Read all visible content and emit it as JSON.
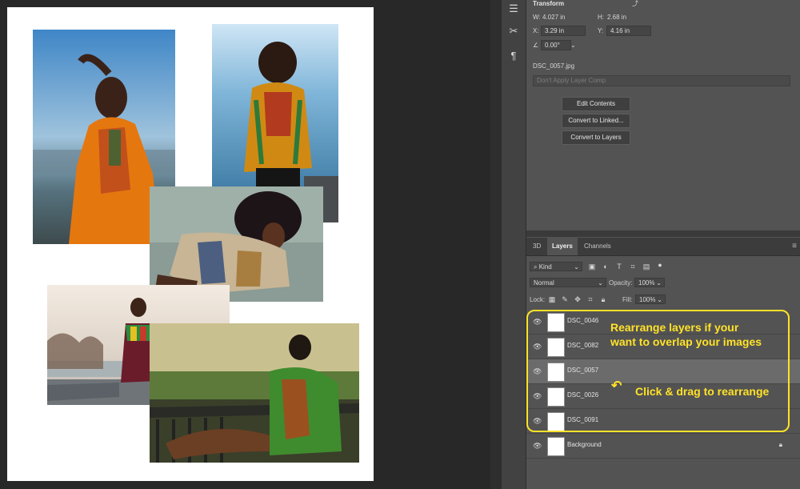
{
  "properties": {
    "section_title": "Transform",
    "width_label": "W:",
    "width_value": "4.027 in",
    "height_label": "H:",
    "height_value": "2.68 in",
    "x_label": "X:",
    "x_value": "3.29 in",
    "y_label": "Y:",
    "y_value": "4.16 in",
    "angle_value": "0.00°",
    "filename": "DSC_0057.jpg",
    "layer_comp_placeholder": "Don't Apply Layer Comp",
    "edit_contents_label": "Edit Contents",
    "convert_linked_label": "Convert to Linked...",
    "convert_layers_label": "Convert to Layers"
  },
  "tabs": [
    {
      "label": "3D",
      "active": false
    },
    {
      "label": "Layers",
      "active": true
    },
    {
      "label": "Channels",
      "active": false
    }
  ],
  "filter": {
    "kind_label": "Kind"
  },
  "blend": {
    "mode": "Normal",
    "opacity_label": "Opacity:",
    "opacity_value": "100%"
  },
  "lock": {
    "lock_label": "Lock:",
    "fill_label": "Fill:",
    "fill_value": "100%"
  },
  "layers": [
    {
      "name": "DSC_0046",
      "selected": false
    },
    {
      "name": "DSC_0082",
      "selected": false
    },
    {
      "name": "DSC_0057",
      "selected": true
    },
    {
      "name": "DSC_0026",
      "selected": false
    },
    {
      "name": "DSC_0091",
      "selected": false
    },
    {
      "name": "Background",
      "selected": false
    }
  ],
  "annotations": {
    "line1": "Rearrange layers if your",
    "line2": "want to overlap your images",
    "drag": "Click & drag to rearrange"
  },
  "colors": {
    "accent": "#ffe229",
    "panel": "#535353"
  }
}
